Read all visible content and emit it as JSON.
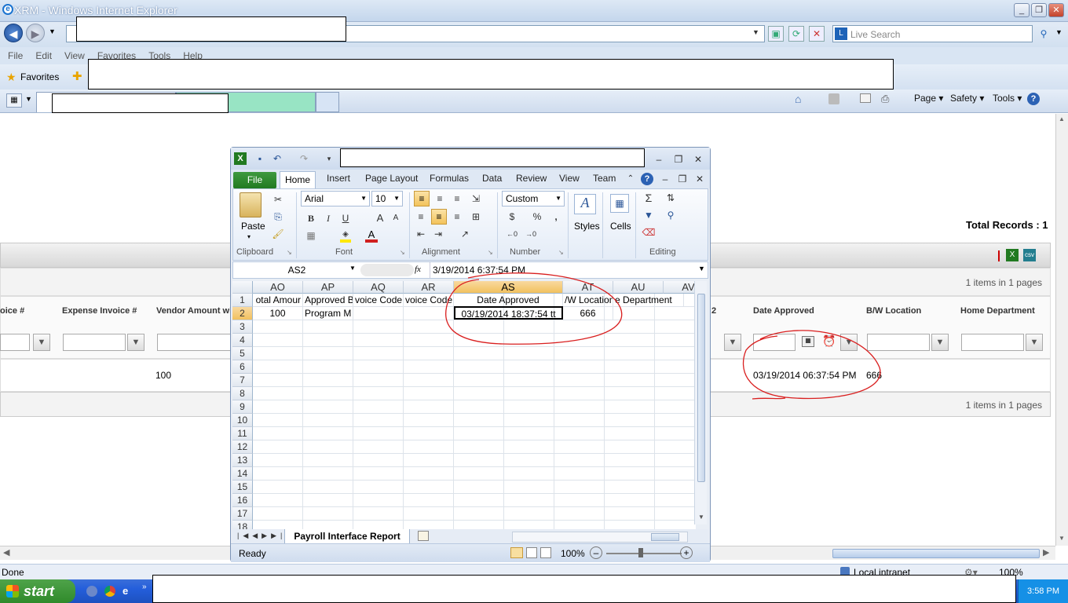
{
  "ie": {
    "title": "XRM - Windows Internet Explorer",
    "menu": [
      "File",
      "Edit",
      "View",
      "Favorites",
      "Tools",
      "Help"
    ],
    "search_placeholder": "Live Search",
    "favorites_label": "Favorites",
    "cmd": {
      "page": "Page ▾",
      "safety": "Safety ▾",
      "tools": "Tools ▾"
    },
    "status_left": "Done",
    "status_zone": "Local intranet",
    "zoom": "100%"
  },
  "report": {
    "total_records": "Total Records : 1",
    "paging_top": "1 items in 1 pages",
    "paging_bottom": "1 items in 1 pages",
    "columns": [
      "oice #",
      "Expense Invoice #",
      "Vendor Amount wi",
      "2",
      "Date Approved",
      "B/W Location",
      "Home Department"
    ],
    "row": {
      "vendor_amount": "100",
      "date_approved": "03/19/2014 06:37:54 PM",
      "bw_location": "666"
    }
  },
  "excel": {
    "ribbon_tabs": [
      "File",
      "Home",
      "Insert",
      "Page Layout",
      "Formulas",
      "Data",
      "Review",
      "View",
      "Team"
    ],
    "groups": [
      "Clipboard",
      "Font",
      "Alignment",
      "Number",
      "Editing"
    ],
    "paste_label": "Paste",
    "styles_label": "Styles",
    "cells_label": "Cells",
    "font_name": "Arial",
    "font_size": "10",
    "number_format": "Custom",
    "name_box": "AS2",
    "fx": "fx",
    "formula": "3/19/2014  6:37:54 PM",
    "col_headers": [
      "AO",
      "AP",
      "AQ",
      "AR",
      "AS",
      "AT",
      "AU",
      "AV"
    ],
    "header_row": [
      "otal Amour",
      "Approved B",
      "voice Code",
      "voice Code",
      "Date Approved",
      "/W Location",
      "e Department",
      ""
    ],
    "data_row": [
      "100",
      "Program M",
      "",
      "",
      "03/19/2014 18:37:54 tt",
      "666",
      "",
      ""
    ],
    "rows": [
      "1",
      "2",
      "3",
      "4",
      "5",
      "6",
      "7",
      "8",
      "9",
      "10",
      "11",
      "12",
      "13",
      "14",
      "15",
      "16",
      "17",
      "18"
    ],
    "sheet_tab": "Payroll Interface Report",
    "status": "Ready",
    "zoom": "100%"
  },
  "taskbar": {
    "start": "start",
    "clock": "3:58 PM"
  },
  "colors": {
    "annotation": "#d91f1f",
    "excel_green": "#217a21",
    "selection": "#f1c15f"
  }
}
